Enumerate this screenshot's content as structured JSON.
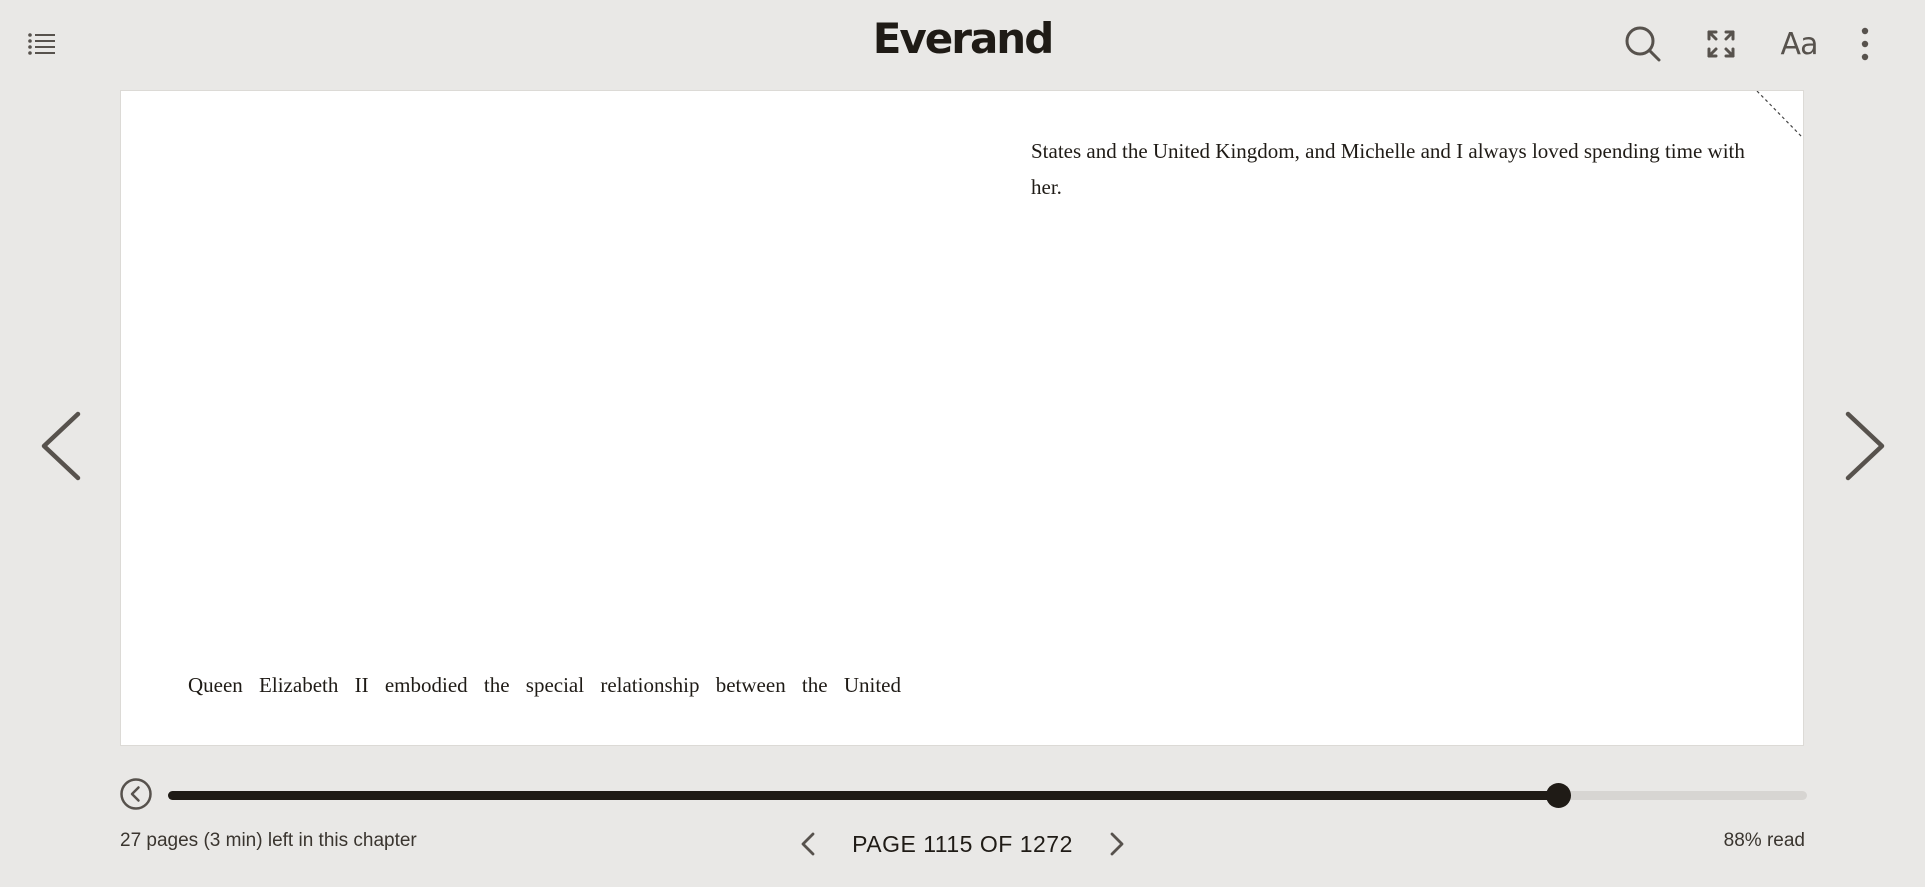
{
  "app": {
    "logo": "Everand"
  },
  "header": {
    "toc_icon": "list-icon",
    "search_icon": "search-icon",
    "fullscreen_icon": "expand-icon",
    "font_settings_label": "Aa",
    "more_icon": "more-vertical-icon"
  },
  "book": {
    "right_page_text": "States and the United Kingdom, and Michelle and I always loved spending time with her.",
    "left_page_text": "Queen Elizabeth II embodied the special relationship between the United"
  },
  "footer": {
    "chapter_remaining": "27 pages (3 min) left in this chapter",
    "page_indicator": "PAGE 1115 OF 1272",
    "percent_read": "88% read",
    "progress_fraction": 0.848
  },
  "colors": {
    "background": "#e9e8e6",
    "accent": "#1f1b16",
    "track": "#d7d5d2"
  }
}
